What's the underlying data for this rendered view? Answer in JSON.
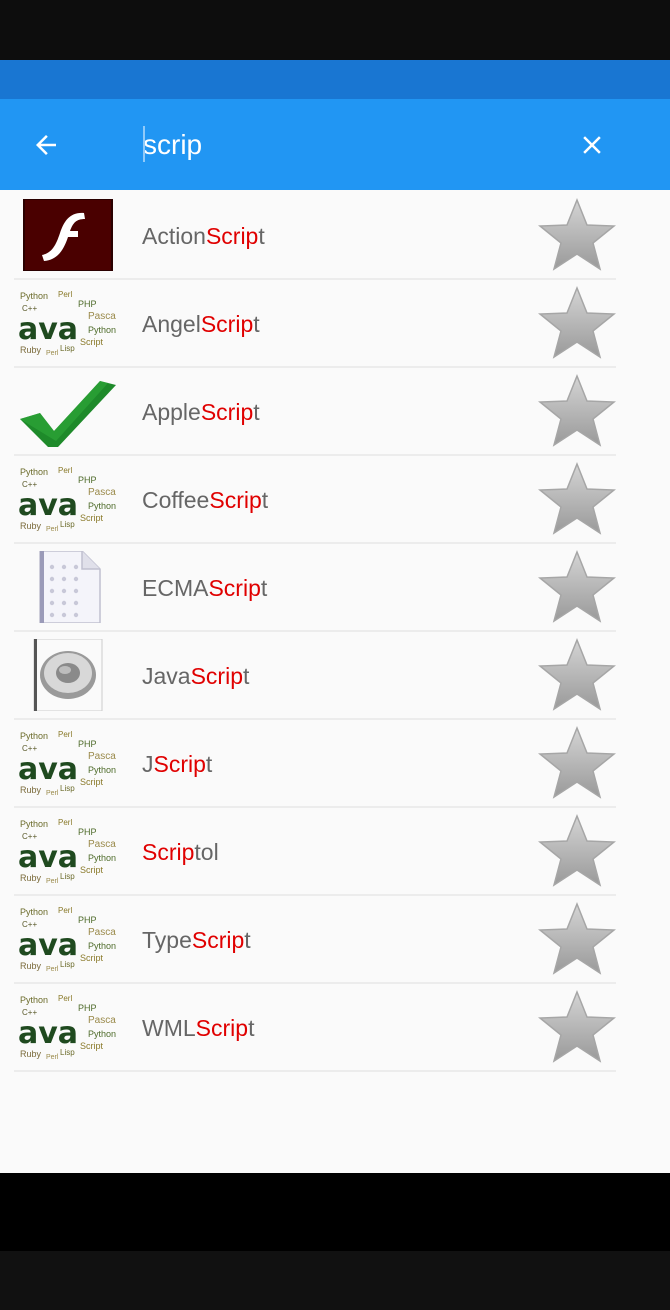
{
  "search": {
    "query": "scrip"
  },
  "results": [
    {
      "pre": "Action",
      "match": "Scrip",
      "post": "t",
      "icon": "flash-logo-icon"
    },
    {
      "pre": "Angel",
      "match": "Scrip",
      "post": "t",
      "icon": "language-wordcloud-icon"
    },
    {
      "pre": "Apple",
      "match": "Scrip",
      "post": "t",
      "icon": "checkmark-icon"
    },
    {
      "pre": "Coffee",
      "match": "Scrip",
      "post": "t",
      "icon": "language-wordcloud-icon"
    },
    {
      "pre": "ECMA",
      "match": "Scrip",
      "post": "t",
      "icon": "document-icon"
    },
    {
      "pre": "Java",
      "match": "Scrip",
      "post": "t",
      "icon": "speaker-icon"
    },
    {
      "pre": "J",
      "match": "Scrip",
      "post": "t",
      "icon": "language-wordcloud-icon"
    },
    {
      "pre": "",
      "match": "Scrip",
      "post": "tol",
      "icon": "language-wordcloud-icon"
    },
    {
      "pre": "Type",
      "match": "Scrip",
      "post": "t",
      "icon": "language-wordcloud-icon"
    },
    {
      "pre": "WML",
      "match": "Scrip",
      "post": "t",
      "icon": "language-wordcloud-icon"
    }
  ],
  "colors": {
    "toolbar": "#2196F3",
    "status_band": "#1976D2",
    "highlight": "#e00000",
    "label": "#666666",
    "star": "#b0b0b0"
  },
  "icons": {
    "back": "arrow-left-icon",
    "clear": "close-icon",
    "favorite": "star-icon"
  },
  "wordcloud": {
    "main": "ava",
    "words": [
      "Python",
      "Perl",
      "PHP",
      "Pascal",
      "C++",
      "Ruby",
      "Lisp",
      "Script"
    ]
  }
}
